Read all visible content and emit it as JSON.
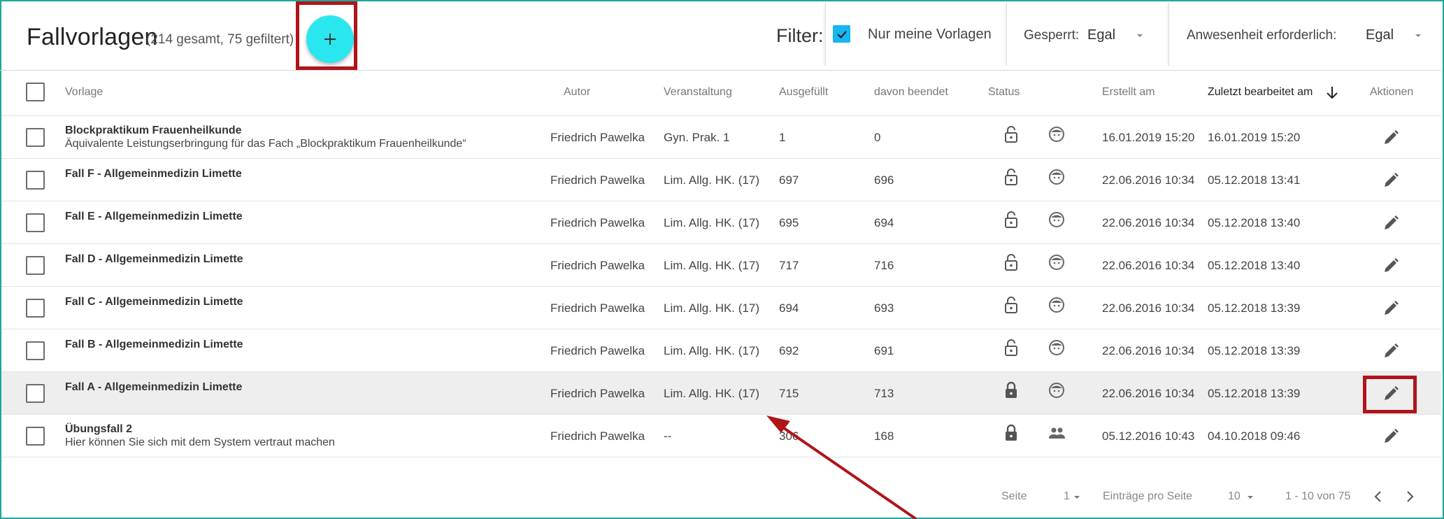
{
  "header": {
    "title": "Fallvorlagen",
    "counts": "(214 gesamt, 75 gefiltert)",
    "add_label": "+"
  },
  "filter": {
    "label": "Filter:",
    "own_only": {
      "label": "Nur meine Vorlagen",
      "checked": true
    },
    "locked": {
      "label": "Gesperrt:",
      "value": "Egal"
    },
    "attendance": {
      "label": "Anwesenheit erforderlich:",
      "value": "Egal"
    }
  },
  "table": {
    "columns": {
      "template": "Vorlage",
      "author": "Autor",
      "event": "Veranstaltung",
      "filled": "Ausgefüllt",
      "finished": "davon beendet",
      "status": "Status",
      "created": "Erstellt am",
      "edited": "Zuletzt bearbeitet am",
      "actions": "Aktionen"
    },
    "sort": {
      "column": "edited",
      "direction": "desc"
    },
    "rows": [
      {
        "title": "Blockpraktikum Frauenheilkunde",
        "subtitle": "Äquivalente Leistungserbringung für das Fach „Blockpraktikum Frauenheilkunde“",
        "author": "Friedrich Pawelka",
        "event": "Gyn. Prak. 1",
        "filled": "1",
        "finished": "0",
        "lock": "unlocked",
        "mode": "single",
        "created": "16.01.2019 15:20",
        "edited": "16.01.2019 15:20"
      },
      {
        "title": "Fall F - Allgemeinmedizin Limette",
        "subtitle": "",
        "author": "Friedrich Pawelka",
        "event": "Lim. Allg. HK. (17)",
        "filled": "697",
        "finished": "696",
        "lock": "unlocked",
        "mode": "single",
        "created": "22.06.2016 10:34",
        "edited": "05.12.2018 13:41"
      },
      {
        "title": "Fall E - Allgemeinmedizin Limette",
        "subtitle": "",
        "author": "Friedrich Pawelka",
        "event": "Lim. Allg. HK. (17)",
        "filled": "695",
        "finished": "694",
        "lock": "unlocked",
        "mode": "single",
        "created": "22.06.2016 10:34",
        "edited": "05.12.2018 13:40"
      },
      {
        "title": "Fall D - Allgemeinmedizin Limette",
        "subtitle": "",
        "author": "Friedrich Pawelka",
        "event": "Lim. Allg. HK. (17)",
        "filled": "717",
        "finished": "716",
        "lock": "unlocked",
        "mode": "single",
        "created": "22.06.2016 10:34",
        "edited": "05.12.2018 13:40"
      },
      {
        "title": "Fall C - Allgemeinmedizin Limette",
        "subtitle": "",
        "author": "Friedrich Pawelka",
        "event": "Lim. Allg. HK. (17)",
        "filled": "694",
        "finished": "693",
        "lock": "unlocked",
        "mode": "single",
        "created": "22.06.2016 10:34",
        "edited": "05.12.2018 13:39"
      },
      {
        "title": "Fall B - Allgemeinmedizin Limette",
        "subtitle": "",
        "author": "Friedrich Pawelka",
        "event": "Lim. Allg. HK. (17)",
        "filled": "692",
        "finished": "691",
        "lock": "unlocked",
        "mode": "single",
        "created": "22.06.2016 10:34",
        "edited": "05.12.2018 13:39"
      },
      {
        "title": "Fall A - Allgemeinmedizin Limette",
        "subtitle": "",
        "author": "Friedrich Pawelka",
        "event": "Lim. Allg. HK. (17)",
        "filled": "715",
        "finished": "713",
        "lock": "locked",
        "mode": "single",
        "created": "22.06.2016 10:34",
        "edited": "05.12.2018 13:39"
      },
      {
        "title": "Übungsfall 2",
        "subtitle": "Hier können Sie sich mit dem System vertraut machen",
        "author": "Friedrich Pawelka",
        "event": "--",
        "filled": "306",
        "finished": "168",
        "lock": "locked",
        "mode": "group",
        "created": "05.12.2016 10:43",
        "edited": "04.10.2018 09:46"
      }
    ]
  },
  "footer": {
    "page_label": "Seite",
    "page_value": "1",
    "per_page_label": "Einträge pro Seite",
    "per_page_value": "10",
    "range": "1 - 10 von 75"
  },
  "colors": {
    "frame": "#1ba89a",
    "fab": "#2ae6ee",
    "checkbox": "#16b7f0",
    "highlight": "#b0141b"
  }
}
